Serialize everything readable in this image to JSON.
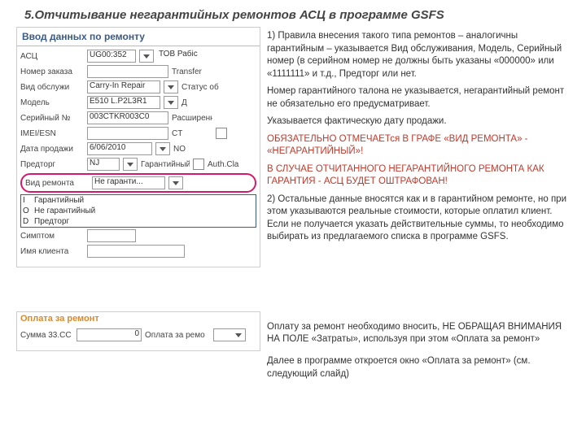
{
  "title": "5.Отчитывание негарантийных ремонтов АСЦ в программе GSFS",
  "panel": {
    "heading": "Ввод данных по ремонту",
    "labels": {
      "asc": "АСЦ",
      "orderNo": "Номер заказа",
      "serviceType": "Вид обслужи",
      "model": "Модель",
      "serial": "Серийный №",
      "imei": "IMEI/ESN",
      "saleDate": "Дата продажи",
      "pretorg": "Предторг",
      "repairType": "Вид ремонта",
      "symptom": "Симптом",
      "clientName": "Имя клиента",
      "transfer": "Transfer",
      "status": "Статус об",
      "d": "Д",
      "extended": "Расширенна",
      "ct": "CT",
      "no": "NO",
      "authCla": "Auth.Cla",
      "warranty": "Гарантийный"
    },
    "values": {
      "asc": "UG00:352",
      "asc2": "ТОВ Рабіс",
      "serviceType": "Carry-In Repair",
      "model": "E510 L.P2L3R1",
      "serial": "003CTKR003C0",
      "saleDate": "6/06/2010",
      "pretorg": "NJ",
      "repairType": "Не гаранти..."
    },
    "dropdown": [
      {
        "code": "I",
        "label": "Гарантийный"
      },
      {
        "code": "O",
        "label": "Не гарантийный"
      },
      {
        "code": "D",
        "label": "Предторг"
      }
    ]
  },
  "text": {
    "p1a": "1) Правила внесения такого типа ремонтов – аналогичны гарантийным – указывается Вид обслуживания, Модель, Серийный номер (в серийном номер не должны быть указаны «000000» или «1111111» и т.д., Предторг или нет.",
    "p2": "Номер гарантийного талона не указывается, негарантийный ремонт не обязательно его предусматривает.",
    "p3": "Указывается фактическую дату продажи.",
    "p4": "ОБЯЗАТЕЛЬНО ОТМЕЧАЕТся В ГРАФЕ «ВИД РЕМОНТА» - «НЕГАРАНТИЙНЫЙ»!",
    "p5": "В СЛУЧАЕ ОТЧИТАННОГО НЕГАРАНТИЙНОГО РЕМОНТА КАК ГАРАНТИЯ - АСЦ БУДЕТ ОШТРАФОВАН!",
    "p6": "2) Остальные данные вносятся как и в гарантийном ремонте, но при этом указываются реальные стоимости, которые оплатил клиент. Если не получается указать действительные суммы, то необходимо выбирать из предлагаемого списка в программе GSFS."
  },
  "payment": {
    "heading": "Оплата за ремонт",
    "sum": "Сумма 33.CC",
    "zero": "0",
    "payLabel": "Оплата за ремо",
    "p1": "Оплату за ремонт необходимо вносить, НЕ ОБРАЩАЯ ВНИМАНИЯ НА ПОЛЕ «Затраты», используя при этом «Оплата за ремонт»",
    "p2": "Далее в программе откроется окно «Оплата за ремонт» (см. следующий слайд)"
  }
}
